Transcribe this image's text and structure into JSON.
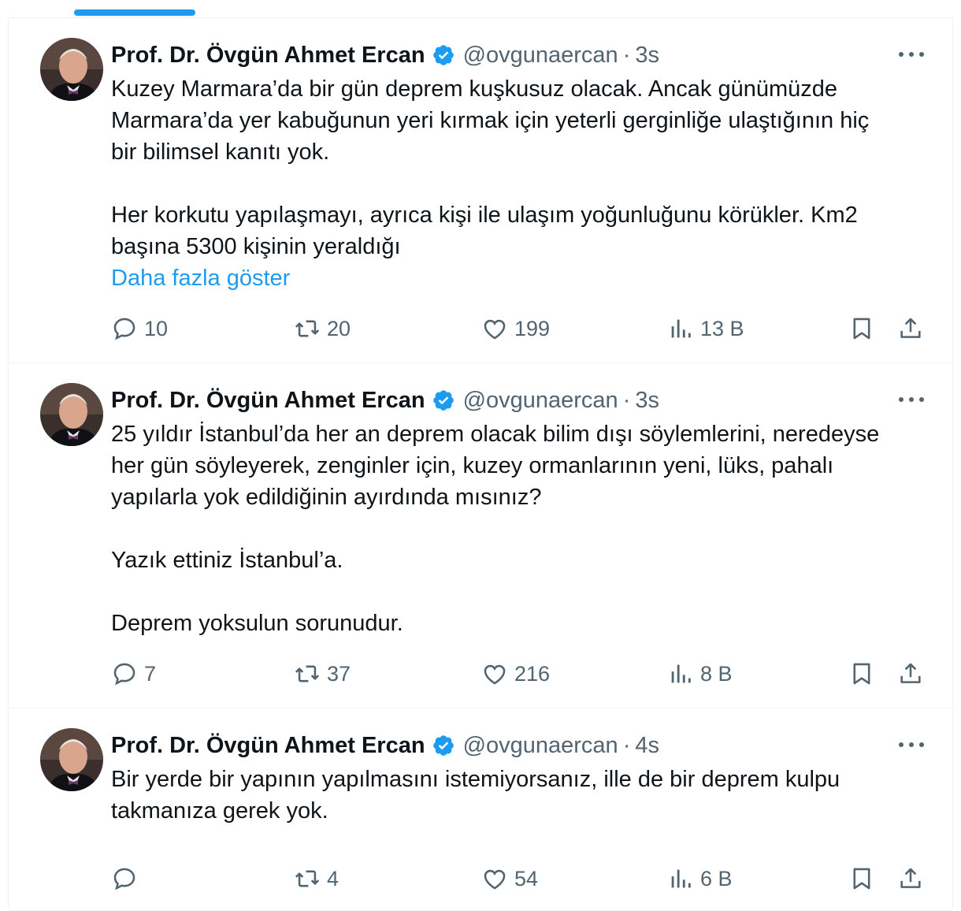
{
  "author": {
    "name": "Prof. Dr. Övgün Ahmet Ercan",
    "handle": "@ovgunaercan",
    "separator": "·"
  },
  "colors": {
    "accent": "#1d9bf0",
    "text": "#0f1419",
    "muted": "#536471",
    "border": "#eff3f4"
  },
  "tweets": [
    {
      "time": "3s",
      "paragraphs": [
        "Kuzey Marmara’da bir gün deprem kuşkusuz olacak. Ancak günümüzde",
        "Marmara’da yer kabuğunun yeri kırmak için yeterli gerginliğe ulaştığının hiç",
        "bir bilimsel kanıtı yok.",
        "",
        "Her korkutu yapılaşmayı, ayrıca kişi ile ulaşım yoğunluğunu  körükler. Km2",
        "başına 5300 kişinin yeraldığı"
      ],
      "show_more": "Daha fazla göster",
      "replies": "10",
      "retweets": "20",
      "likes": "199",
      "views": "13 B"
    },
    {
      "time": "3s",
      "paragraphs": [
        "25 yıldır İstanbul’da her an deprem olacak bilim dışı söylemlerini, neredeyse",
        "her gün söyleyerek, zenginler için, kuzey ormanlarının yeni, lüks, pahalı",
        "yapılarla yok edildiğinin ayırdında mısınız?",
        "",
        "Yazık ettiniz İstanbul’a.",
        "",
        "Deprem yoksulun sorunudur."
      ],
      "show_more": "",
      "replies": "7",
      "retweets": "37",
      "likes": "216",
      "views": "8 B"
    },
    {
      "time": "4s",
      "paragraphs": [
        "Bir yerde bir yapının yapılmasını istemiyorsanız, ille de bir deprem kulpu",
        "takmanıza gerek yok."
      ],
      "show_more": "",
      "replies": "",
      "retweets": "4",
      "likes": "54",
      "views": "6 B"
    }
  ]
}
